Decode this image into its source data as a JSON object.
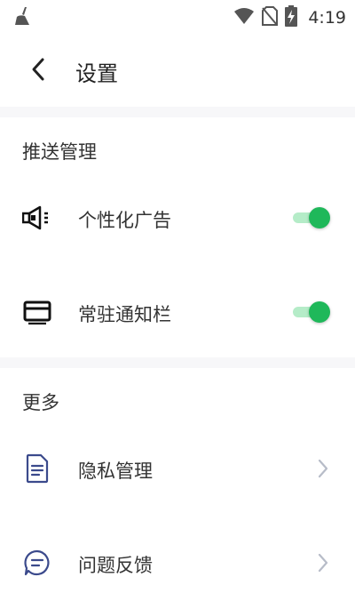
{
  "status_bar": {
    "time": "4:19",
    "icons": [
      "cleaner-broom-icon",
      "wifi-icon",
      "no-sim-icon",
      "battery-charging-icon"
    ]
  },
  "header": {
    "title": "设置",
    "back_icon": "chevron-left-icon"
  },
  "sections": [
    {
      "title": "推送管理",
      "items": [
        {
          "label": "个性化广告",
          "icon": "megaphone-icon",
          "control": "toggle",
          "on": true
        },
        {
          "label": "常驻通知栏",
          "icon": "notification-bar-icon",
          "control": "toggle",
          "on": true
        }
      ]
    },
    {
      "title": "更多",
      "items": [
        {
          "label": "隐私管理",
          "icon": "document-icon",
          "control": "chevron"
        },
        {
          "label": "问题反馈",
          "icon": "chat-bubble-icon",
          "control": "chevron"
        }
      ]
    }
  ],
  "colors": {
    "accent_green": "#1fb85a",
    "toggle_track": "#b5ecc8",
    "divider": "#f7f7f9",
    "icon_blue": "#3b4a8c"
  }
}
